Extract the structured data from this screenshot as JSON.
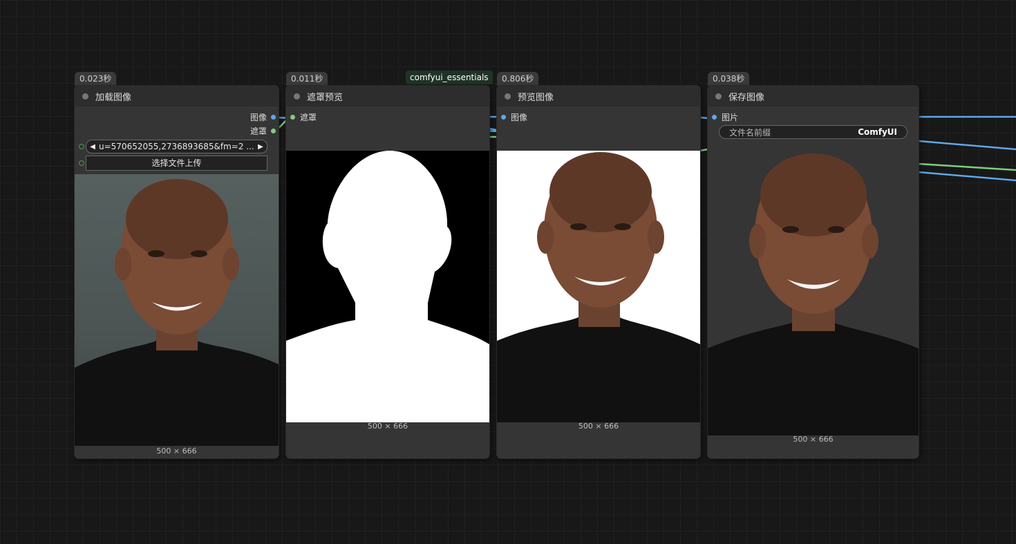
{
  "nodes": [
    {
      "time": "0.023秒",
      "title": "加载图像",
      "outputs": [
        "图像",
        "遮罩"
      ],
      "image_widget": {
        "value": "u=570652055,2736893685&fm=2 ...",
        "prev_icon": "◀",
        "next_icon": "▶"
      },
      "upload_button": "选择文件上传",
      "dimensions": "500 × 666"
    },
    {
      "time": "0.011秒",
      "badge": "comfyui_essentials",
      "title": "遮罩预览",
      "inputs": [
        "遮罩"
      ],
      "dimensions": "500 × 666"
    },
    {
      "time": "0.806秒",
      "title": "预览图像",
      "inputs": [
        "图像"
      ],
      "dimensions": "500 × 666"
    },
    {
      "time": "0.038秒",
      "title": "保存图像",
      "inputs": [
        "图片"
      ],
      "filename_prefix": {
        "label": "文件名前缀",
        "value": "ComfyUI"
      },
      "dimensions": "500 × 666"
    }
  ],
  "colors": {
    "image_link": "#5fa8e8",
    "mask_link": "#7ecf7e",
    "canvas": "#181818",
    "node_body": "#353535",
    "node_title": "#2d2d2d"
  }
}
